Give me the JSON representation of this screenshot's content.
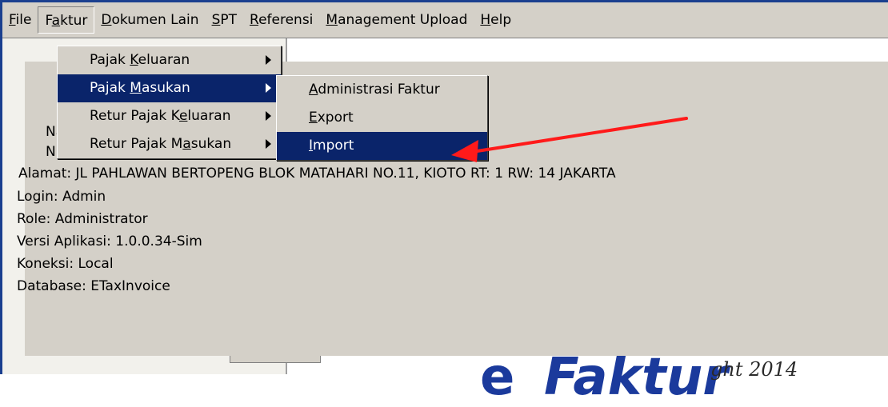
{
  "menubar": {
    "items": [
      {
        "label": "File",
        "underline_index": 0
      },
      {
        "label": "Faktur",
        "underline_index": 1
      },
      {
        "label": "Dokumen Lain",
        "underline_index": 0
      },
      {
        "label": "SPT",
        "underline_index": 0
      },
      {
        "label": "Referensi",
        "underline_index": 0
      },
      {
        "label": "Management Upload",
        "underline_index": 0
      },
      {
        "label": "Help",
        "underline_index": 0
      }
    ],
    "active": "Faktur"
  },
  "faktur_menu": {
    "items": [
      {
        "label": "Pajak Keluaran",
        "has_submenu": true,
        "highlighted": false
      },
      {
        "label": "Pajak Masukan",
        "has_submenu": true,
        "highlighted": true
      },
      {
        "label": "Retur Pajak Keluaran",
        "has_submenu": true,
        "highlighted": false
      },
      {
        "label": "Retur Pajak Masukan",
        "has_submenu": true,
        "highlighted": false
      }
    ]
  },
  "pajak_masukan_submenu": {
    "items": [
      {
        "label": "Administrasi Faktur",
        "highlighted": false
      },
      {
        "label": "Export",
        "highlighted": false
      },
      {
        "label": "Import",
        "highlighted": true
      }
    ]
  },
  "info": {
    "nama_prefix": "Nam",
    "npwp_prefix": "NPW",
    "alamat": "Alamat: JL PAHLAWAN BERTOPENG BLOK MATAHARI NO.11, KIOTO RT: 1 RW: 14 JAKARTA",
    "alamat_visible_tail": "1, KIOTO RT: 1 RW: 14 JAKARTA",
    "login": "Login: Admin",
    "role": "Role: Administrator",
    "versi": "Versi Aplikasi: 1.0.0.34-Sim",
    "koneksi": "Koneksi: Local",
    "database": "Database: ETaxInvoice"
  },
  "logo": {
    "letter": "e",
    "word": "Faktur",
    "copyright_fragment": "ght 2014",
    "color": "#1b3a9c"
  },
  "annotation": {
    "arrow_color": "#ff1a1a",
    "points_to": "Import"
  },
  "colors": {
    "window_frame": "#1a3f8f",
    "menu_face": "#d4d0c8",
    "highlight": "#0a246a"
  }
}
